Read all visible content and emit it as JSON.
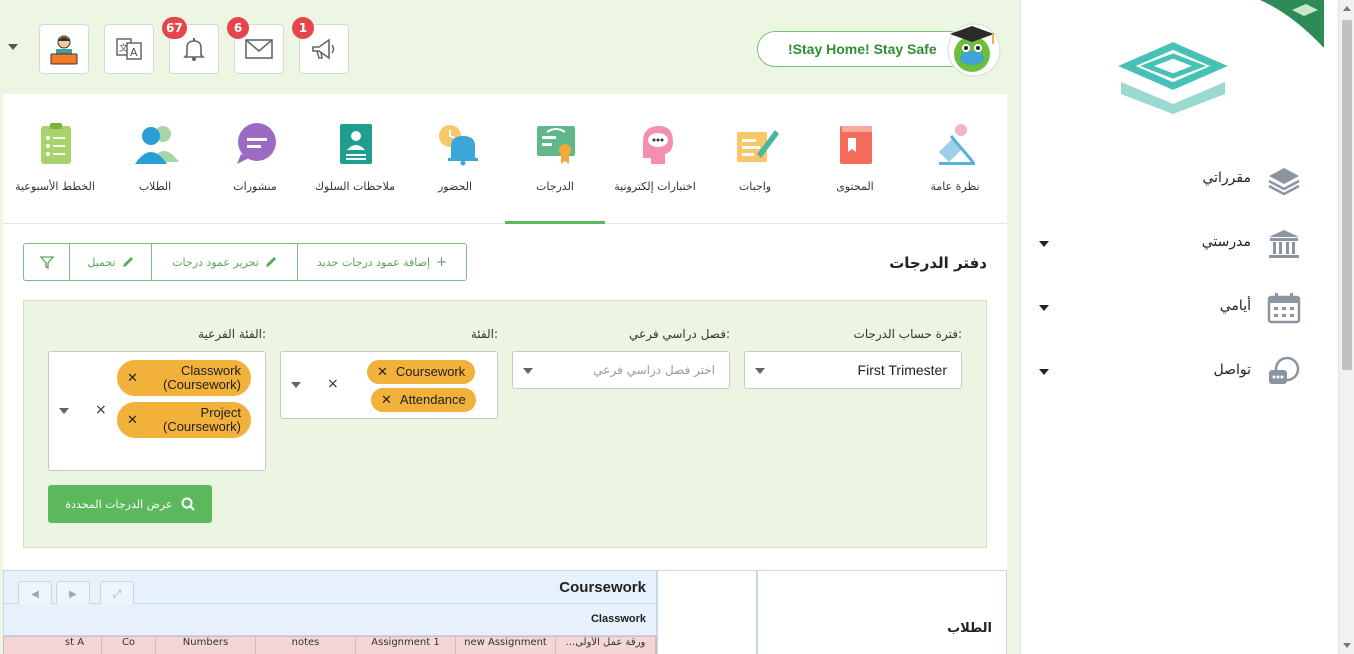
{
  "topbar": {
    "stay_home": "!Stay Home! Stay Safe",
    "notifications_count": "67",
    "messages_count": "6",
    "announcements_count": "1"
  },
  "tabs": [
    {
      "label": "نظرة عامة"
    },
    {
      "label": "المحتوى"
    },
    {
      "label": "واجبات"
    },
    {
      "label": "اختبارات إلكترونية"
    },
    {
      "label": "الدرجات"
    },
    {
      "label": "الحضور"
    },
    {
      "label": "ملاحظات السلوك"
    },
    {
      "label": "منشورات"
    },
    {
      "label": "الطلاب"
    },
    {
      "label": "الخطط الأسبوعية"
    }
  ],
  "gradebook": {
    "title": "دفتر الدرجات",
    "add_column": "إضافة عمود درجات جديد",
    "edit_column": "تحرير عمود درجات",
    "upload": "تحميل"
  },
  "filters": {
    "period_label": "فترة حساب الدرجات:",
    "period_value": "First Trimester",
    "subterm_label": "فصل دراسي فرعي:",
    "subterm_placeholder": "اختر فصل دراسي فرعي",
    "category_label": "الفئة:",
    "category_chips": [
      "Coursework",
      "Attendance"
    ],
    "subcategory_label": "الفئة الفرعية:",
    "subcategory_chips": [
      {
        "line1": "Classwork",
        "line2": "(Coursework)"
      },
      {
        "line1": "Project",
        "line2": "(Coursework)"
      }
    ],
    "search_button": "عرض الدرجات المحددة"
  },
  "grid": {
    "group_header": "Coursework",
    "sub_header": "Classwork",
    "students_header": "الطلاب",
    "columns": [
      "...ورقة عمل الأولى",
      "new Assignment",
      "Assignment 1",
      "notes",
      "Numbers",
      "Co",
      "st A"
    ]
  },
  "sidebar": {
    "items": [
      {
        "label": "مقرراتي"
      },
      {
        "label": "مدرستي"
      },
      {
        "label": "أيامي"
      },
      {
        "label": "تواصل"
      }
    ]
  },
  "colors": {
    "accent_green": "#5cb85c",
    "chip_orange": "#f2b13a",
    "badge_red": "#e4464b",
    "logo_teal": "#45c2b5"
  }
}
